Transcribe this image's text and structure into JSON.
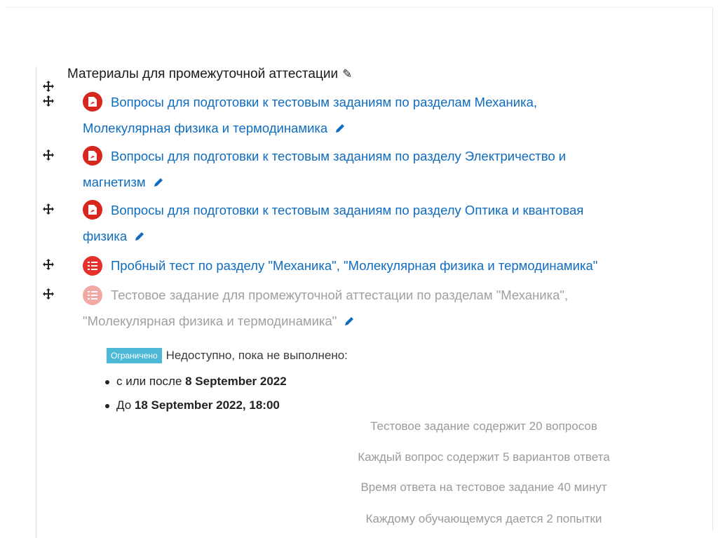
{
  "section": {
    "title": "Материалы для промежуточной аттестации"
  },
  "items": [
    {
      "type": "pdf-icon",
      "line1": "Вопросы для подготовки к тестовым заданиям по разделам Механика,",
      "line2": "Молекулярная физика и термодинамика"
    },
    {
      "type": "pdf-icon",
      "line1": "Вопросы для подготовки к тестовым заданиям по разделу Электричество и",
      "line2": "магнетизм"
    },
    {
      "type": "pdf-icon",
      "line1": "Вопросы для подготовки к тестовым заданиям по разделу Оптика и квантовая",
      "line2": "физика"
    },
    {
      "type": "quiz-icon",
      "line1": "Пробный тест по разделу \"Механика\", \"Молекулярная физика и термодинамика\""
    },
    {
      "type": "quiz-icon",
      "dimmed": true,
      "line1": "Тестовое задание для промежуточной аттестации по разделам \"Механика\",",
      "line2": "\"Молекулярная физика и термодинамика\""
    }
  ],
  "restriction": {
    "badge": "Ограничено",
    "text": "Недоступно, пока не выполнено:",
    "conditions": [
      {
        "prefix": "с или после ",
        "value": "8 September 2022"
      },
      {
        "prefix": "До ",
        "value": "18 September 2022, 18:00"
      }
    ]
  },
  "notes": [
    "Тестовое задание содержит 20 вопросов",
    "Каждый вопрос содержит 5 вариантов ответа",
    "Время ответа на тестовое задание 40 минут",
    "Каждому обучающемуся дается 2 попытки"
  ],
  "colors": {
    "link": "#0f6cbf",
    "pdf": "#d7261e",
    "quiz": "#e5312c",
    "badge": "#4cb9d6",
    "muted": "#9a9a9a"
  }
}
